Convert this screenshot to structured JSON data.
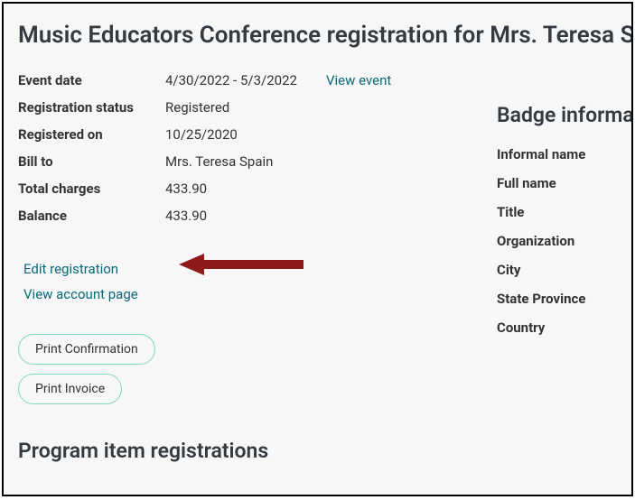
{
  "page_title": "Music Educators Conference registration for Mrs. Teresa Spain",
  "details": {
    "event_date_label": "Event date",
    "event_date_value": "4/30/2022 - 5/3/2022",
    "view_event": "View event",
    "reg_status_label": "Registration status",
    "reg_status_value": "Registered",
    "registered_on_label": "Registered on",
    "registered_on_value": "10/25/2020",
    "bill_to_label": "Bill to",
    "bill_to_value": "Mrs. Teresa Spain",
    "total_charges_label": "Total charges",
    "total_charges_value": "433.90",
    "balance_label": "Balance",
    "balance_value": "433.90"
  },
  "links": {
    "edit_registration": "Edit registration",
    "view_account": "View account page"
  },
  "buttons": {
    "print_confirmation": "Print Confirmation",
    "print_invoice": "Print Invoice"
  },
  "badge": {
    "section": "Badge information",
    "labels": {
      "informal_name": "Informal name",
      "full_name": "Full name",
      "title": "Title",
      "organization": "Organization",
      "city": "City",
      "state_province": "State Province",
      "country": "Country"
    }
  },
  "program_section": "Program item registrations",
  "annotation": {
    "arrow_color": "#8e1a1a"
  }
}
